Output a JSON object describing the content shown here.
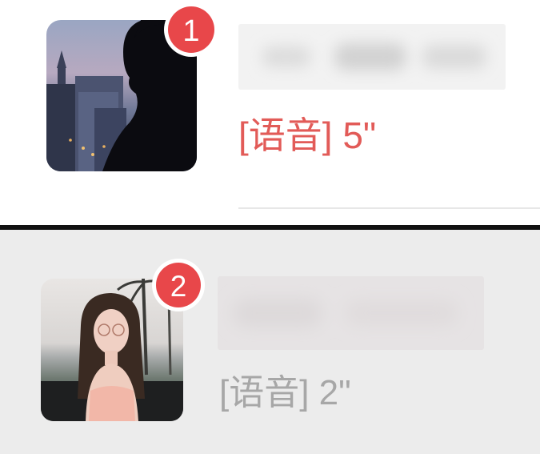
{
  "conversations": [
    {
      "unread_count": "1",
      "last_message_preview": "[语音] 5\"",
      "preview_color": "#e25b58",
      "badge_color": "#e8474a",
      "avatar_icon": "silhouette-city-avatar-icon"
    },
    {
      "unread_count": "2",
      "last_message_preview": "[语音] 2\"",
      "preview_color": "#a7a7a7",
      "badge_color": "#e8474a",
      "avatar_icon": "girl-beach-avatar-icon"
    }
  ]
}
